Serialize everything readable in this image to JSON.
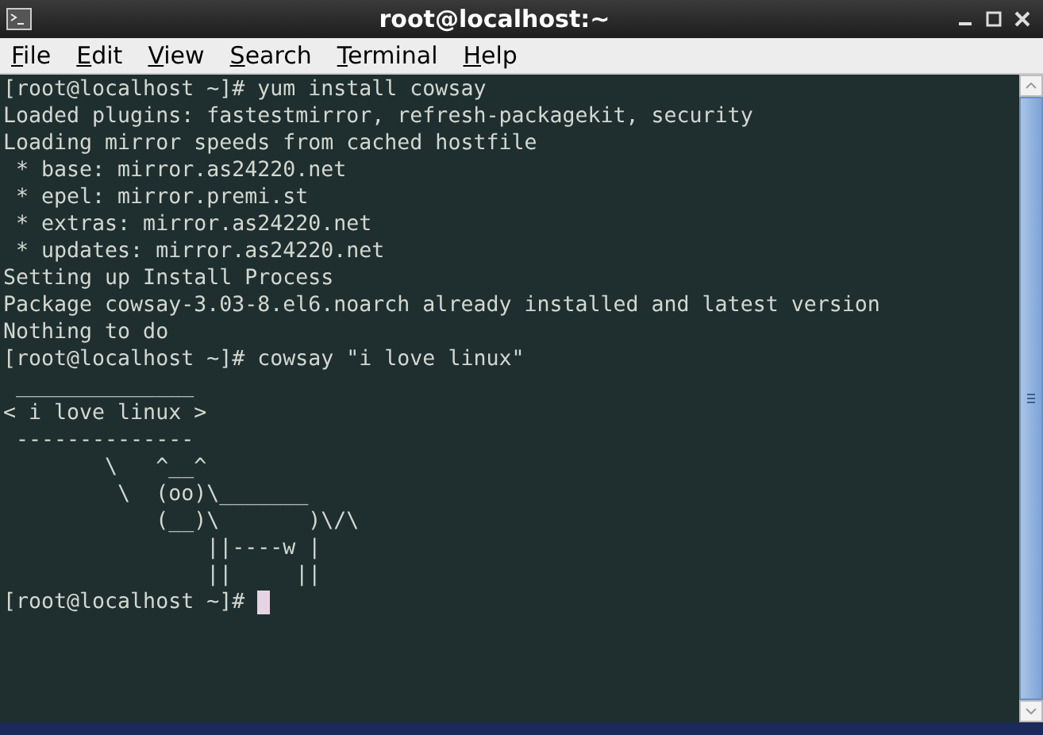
{
  "window": {
    "title": "root@localhost:~"
  },
  "menu": [
    "File",
    "Edit",
    "View",
    "Search",
    "Terminal",
    "Help"
  ],
  "terminal": {
    "lines": [
      "[root@localhost ~]# yum install cowsay",
      "Loaded plugins: fastestmirror, refresh-packagekit, security",
      "Loading mirror speeds from cached hostfile",
      " * base: mirror.as24220.net",
      " * epel: mirror.premi.st",
      " * extras: mirror.as24220.net",
      " * updates: mirror.as24220.net",
      "Setting up Install Process",
      "Package cowsay-3.03-8.el6.noarch already installed and latest version",
      "Nothing to do",
      "[root@localhost ~]# cowsay \"i love linux\"",
      " ______________",
      "< i love linux >",
      " --------------",
      "        \\   ^__^",
      "         \\  (oo)\\_______",
      "            (__)\\       )\\/\\",
      "                ||----w |",
      "                ||     ||"
    ],
    "prompt": "[root@localhost ~]# "
  }
}
